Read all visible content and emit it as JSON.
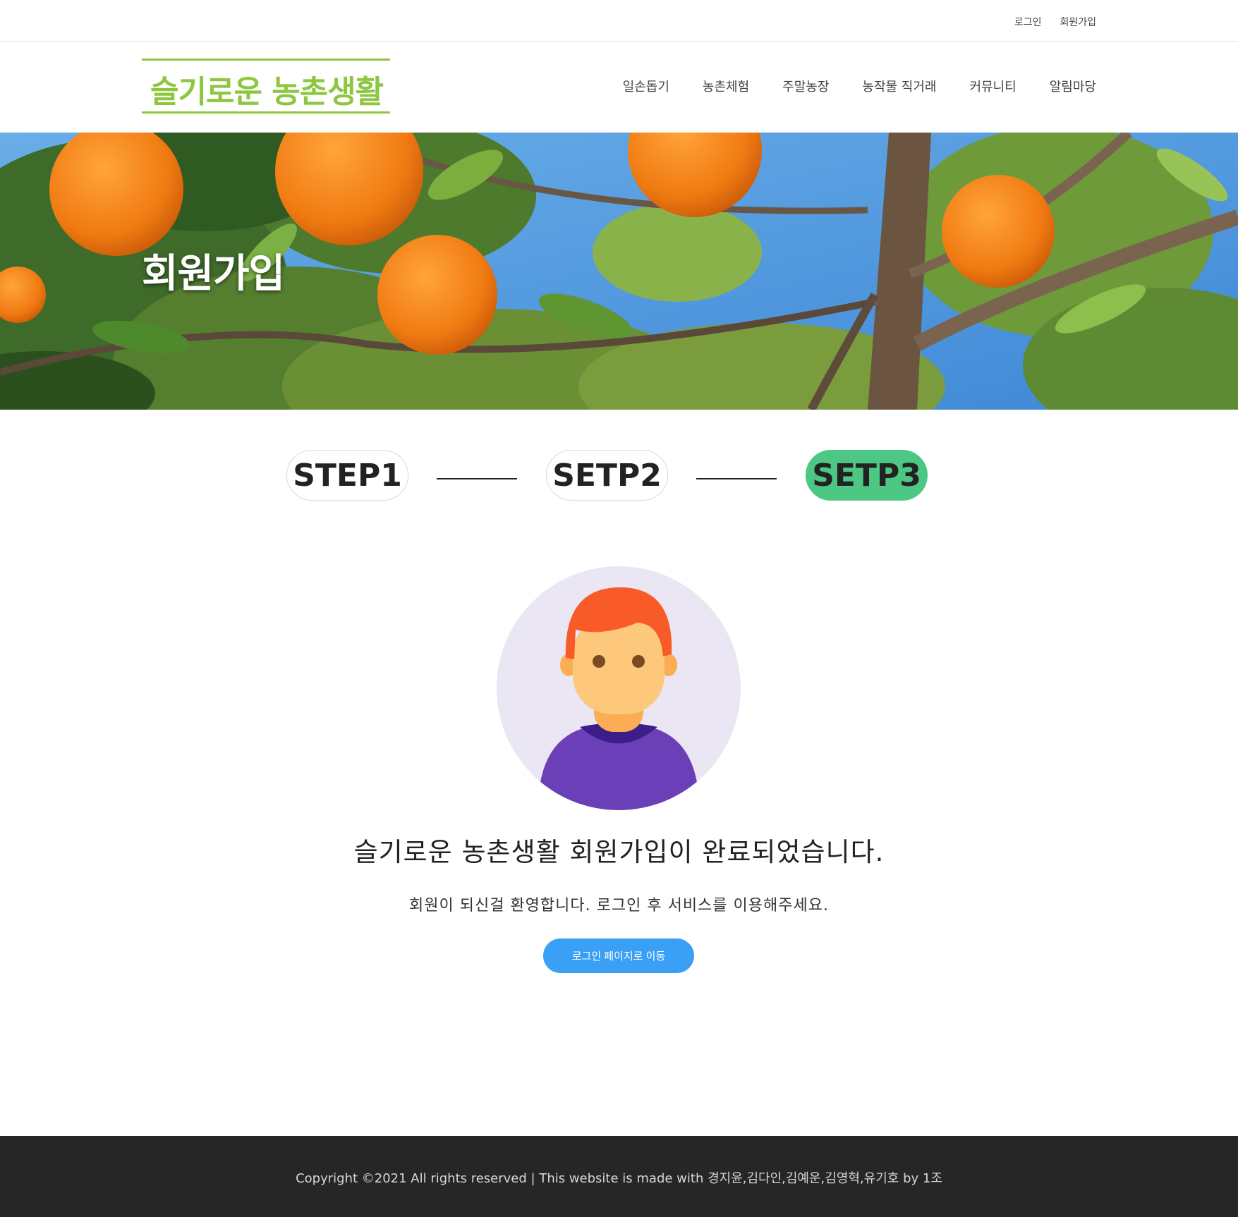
{
  "topbar": {
    "login": "로그인",
    "signup": "회원가입"
  },
  "header": {
    "logo_text": "슬기로운 농촌생활",
    "nav": [
      "일손돕기",
      "농촌체험",
      "주말농장",
      "농작물 직거래",
      "커뮤니티",
      "알림마당"
    ]
  },
  "hero": {
    "title": "회원가입"
  },
  "steps": [
    {
      "label": "STEP1",
      "active": false
    },
    {
      "label": "SETP2",
      "active": false
    },
    {
      "label": "SETP3",
      "active": true
    }
  ],
  "main": {
    "title": "슬기로운 농촌생활 회원가입이 완료되었습니다.",
    "subtitle": "회원이 되신걸 환영합니다. 로그인 후 서비스를 이용해주세요.",
    "button_label": "로그인 페이지로 이동"
  },
  "footer": {
    "copyright": "Copyright ©2021 All rights reserved | This website is made with 경지윤,김다인,김예운,김영혁,유기호 by 1조"
  },
  "colors": {
    "brand_green": "#8dc63f",
    "step_active": "#4cc784",
    "button_blue": "#3aa0f5",
    "footer_bg": "#262626"
  }
}
